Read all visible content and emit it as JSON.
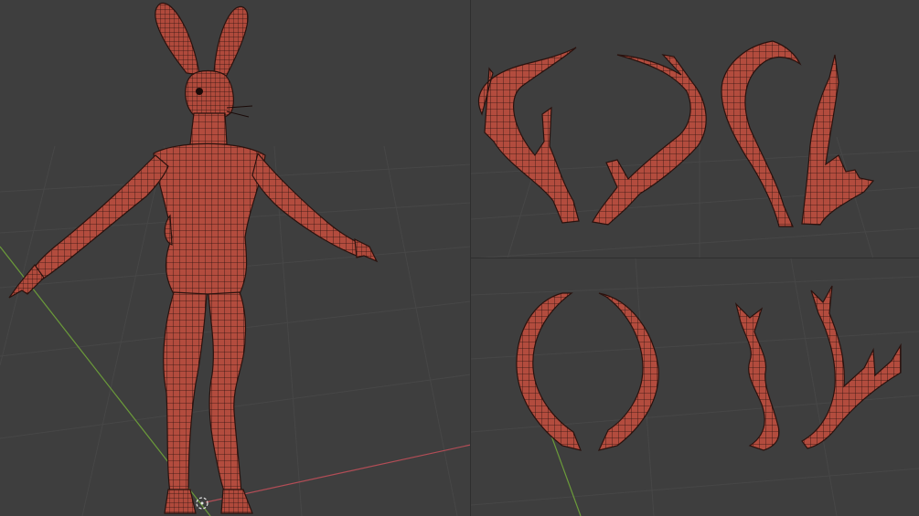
{
  "app": {
    "title": "",
    "grid_color": "#474747",
    "background_color": "#3d3d3d",
    "x_axis_color": "#b24d56",
    "y_axis_color": "#6b9b3a",
    "mesh_color": "#b34c3e",
    "wire_color": "#2a120e"
  },
  "viewports": [
    {
      "id": "character",
      "subject": "rabbit-humanoid-character"
    },
    {
      "id": "antlers-top",
      "subject": "antler-variants-1-2"
    },
    {
      "id": "antlers-bottom",
      "subject": "antler-variants-3-4"
    }
  ],
  "icons": {
    "origin": "3d-cursor-icon"
  }
}
